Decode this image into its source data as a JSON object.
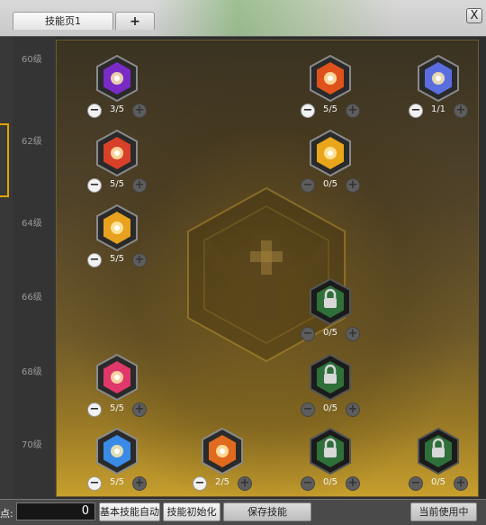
{
  "window": {
    "tabs": [
      {
        "label": "技能页1"
      },
      {
        "label": "+"
      }
    ],
    "close_label": "X"
  },
  "levels": [
    "60级",
    "62级",
    "64级",
    "66级",
    "68级",
    "70级"
  ],
  "skills": [
    {
      "count": "3/5",
      "icon": "purple-orb-icon",
      "color": "#7a2bc6",
      "state": "learned"
    },
    {
      "count": "5/5",
      "icon": "flame-slash-icon",
      "color": "#e0521c",
      "state": "learned"
    },
    {
      "count": "1/1",
      "icon": "portrait-icon",
      "color": "#5b6ee0",
      "state": "learned"
    },
    {
      "count": "5/5",
      "icon": "red-blade-icon",
      "color": "#d8402a",
      "state": "learned"
    },
    {
      "count": "0/5",
      "icon": "golden-shield-icon",
      "color": "#e9a61a",
      "state": "available"
    },
    {
      "count": "5/5",
      "icon": "golden-cube-icon",
      "color": "#e8a21f",
      "state": "learned"
    },
    {
      "count": "0/5",
      "icon": "lock-icon",
      "color": "#2f6f3a",
      "state": "locked"
    },
    {
      "count": "5/5",
      "icon": "pink-slash-icon",
      "color": "#e0386a",
      "state": "learned"
    },
    {
      "count": "0/5",
      "icon": "lock-icon",
      "color": "#2f6f3a",
      "state": "locked"
    },
    {
      "count": "5/5",
      "icon": "blue-cross-icon",
      "color": "#3a8be6",
      "state": "learned"
    },
    {
      "count": "2/5",
      "icon": "orange-figure-icon",
      "color": "#e06a1e",
      "state": "learned"
    },
    {
      "count": "0/5",
      "icon": "lock-icon",
      "color": "#2f6f3a",
      "state": "locked"
    },
    {
      "count": "0/5",
      "icon": "lock-icon",
      "color": "#2f6f3a",
      "state": "locked"
    }
  ],
  "bottom": {
    "sp_label": "点:",
    "sp_value": "0",
    "auto_label": "基本技能自动",
    "reset_label": "技能初始化",
    "save_label": "保存技能",
    "current_label": "当前使用中"
  }
}
